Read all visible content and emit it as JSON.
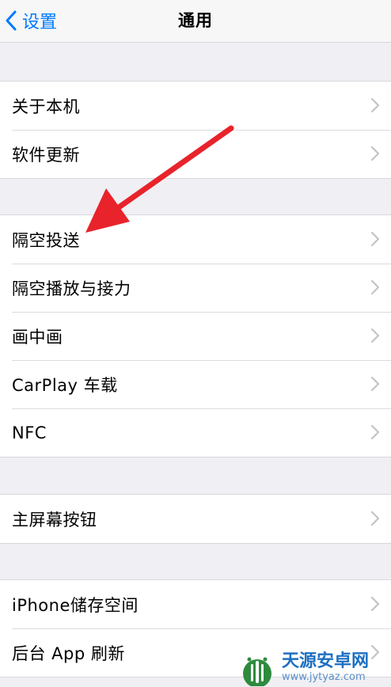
{
  "nav": {
    "back_label": "设置",
    "title": "通用"
  },
  "groups": [
    {
      "items": [
        {
          "label": "关于本机"
        },
        {
          "label": "软件更新"
        }
      ]
    },
    {
      "items": [
        {
          "label": "隔空投送"
        },
        {
          "label": "隔空播放与接力"
        },
        {
          "label": "画中画"
        },
        {
          "label": "CarPlay 车载"
        },
        {
          "label": "NFC"
        }
      ]
    },
    {
      "items": [
        {
          "label": "主屏幕按钮"
        }
      ]
    },
    {
      "items": [
        {
          "label": "iPhone储存空间"
        },
        {
          "label": "后台 App 刷新"
        }
      ]
    }
  ],
  "watermark": {
    "name": "天源安卓网",
    "url": "www.jytyaz.com"
  },
  "colors": {
    "accent": "#007aff",
    "background": "#efeff4",
    "annotation_arrow": "#e8232b",
    "watermark": "#1d6fc2"
  }
}
